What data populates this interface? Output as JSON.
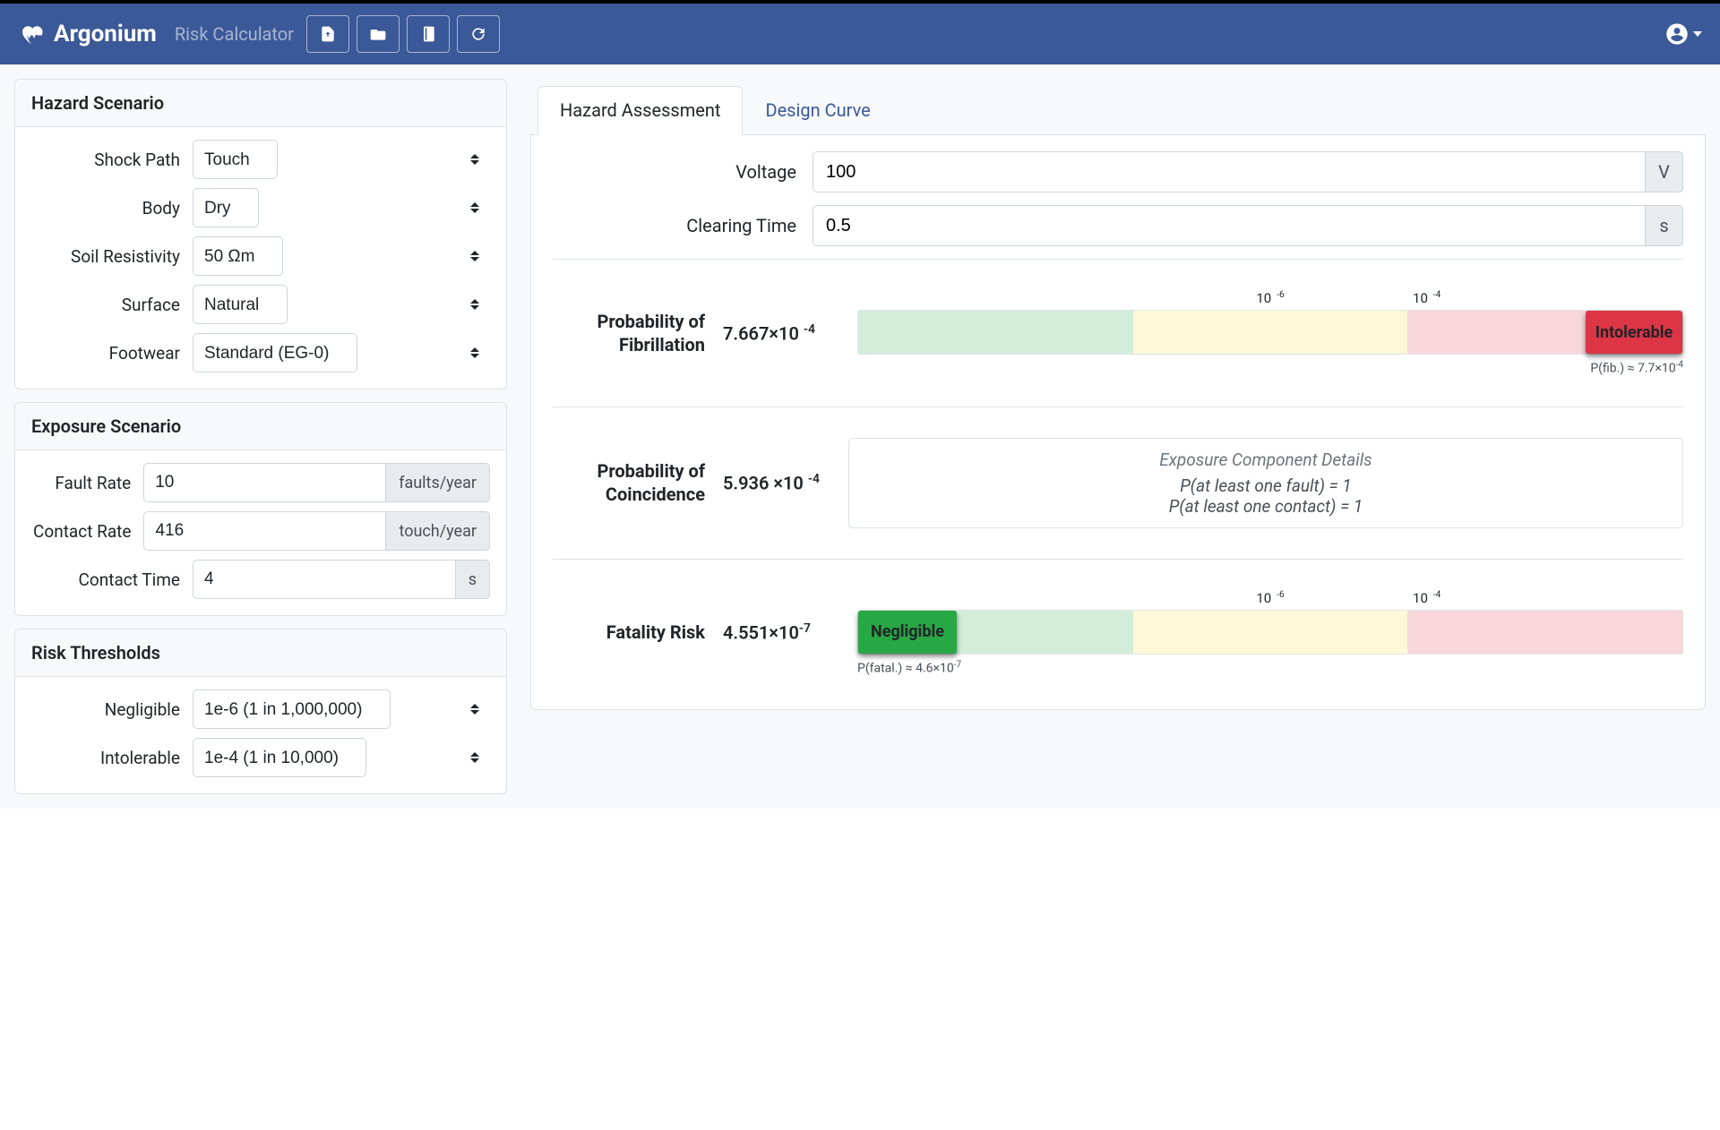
{
  "brand": "Argonium",
  "subtitle": "Risk Calculator",
  "hazard_scenario": {
    "title": "Hazard Scenario",
    "shock_path": {
      "label": "Shock Path",
      "value": "Touch"
    },
    "body": {
      "label": "Body",
      "value": "Dry"
    },
    "soil": {
      "label": "Soil Resistivity",
      "value": "50 Ωm"
    },
    "surface": {
      "label": "Surface",
      "value": "Natural"
    },
    "footwear": {
      "label": "Footwear",
      "value": "Standard (EG-0)"
    }
  },
  "exposure_scenario": {
    "title": "Exposure Scenario",
    "fault_rate": {
      "label": "Fault Rate",
      "value": "10",
      "unit": "faults/year"
    },
    "contact_rate": {
      "label": "Contact Rate",
      "value": "416",
      "unit": "touch/year"
    },
    "contact_time": {
      "label": "Contact Time",
      "value": "4",
      "unit": "s"
    }
  },
  "risk_thresholds": {
    "title": "Risk Thresholds",
    "negligible": {
      "label": "Negligible",
      "value": "1e-6 (1 in 1,000,000)"
    },
    "intolerable": {
      "label": "Intolerable",
      "value": "1e-4 (1 in 10,000)"
    }
  },
  "tabs": {
    "assessment": "Hazard Assessment",
    "design": "Design Curve"
  },
  "inputs": {
    "voltage": {
      "label": "Voltage",
      "value": "100",
      "unit": "V"
    },
    "clearing": {
      "label": "Clearing Time",
      "value": "0.5",
      "unit": "s"
    }
  },
  "results": {
    "fibrillation": {
      "label": "Probability of Fibrillation",
      "value_html": "7.667×10",
      "value_exp": "-4",
      "badge": "Intolerable",
      "caption_prefix": "P(fib.) ≈ 7.7×10",
      "caption_exp": "-4",
      "tick1": "10",
      "tick1_exp": "-6",
      "tick2": "10",
      "tick2_exp": "-4"
    },
    "coincidence": {
      "label": "Probability of Coincidence",
      "value_html": "5.936 ×10",
      "value_exp": "-4",
      "details_title": "Exposure Component Details",
      "line1": "P(at least one fault) = 1",
      "line2": "P(at least one contact) = 1"
    },
    "fatality": {
      "label": "Fatality Risk",
      "value_html": "4.551×10",
      "value_exp": "-7",
      "badge": "Negligible",
      "caption_prefix": "P(fatal.) ≈ 4.6×10",
      "caption_exp": "-7",
      "tick1": "10",
      "tick1_exp": "-6",
      "tick2": "10",
      "tick2_exp": "-4"
    }
  }
}
